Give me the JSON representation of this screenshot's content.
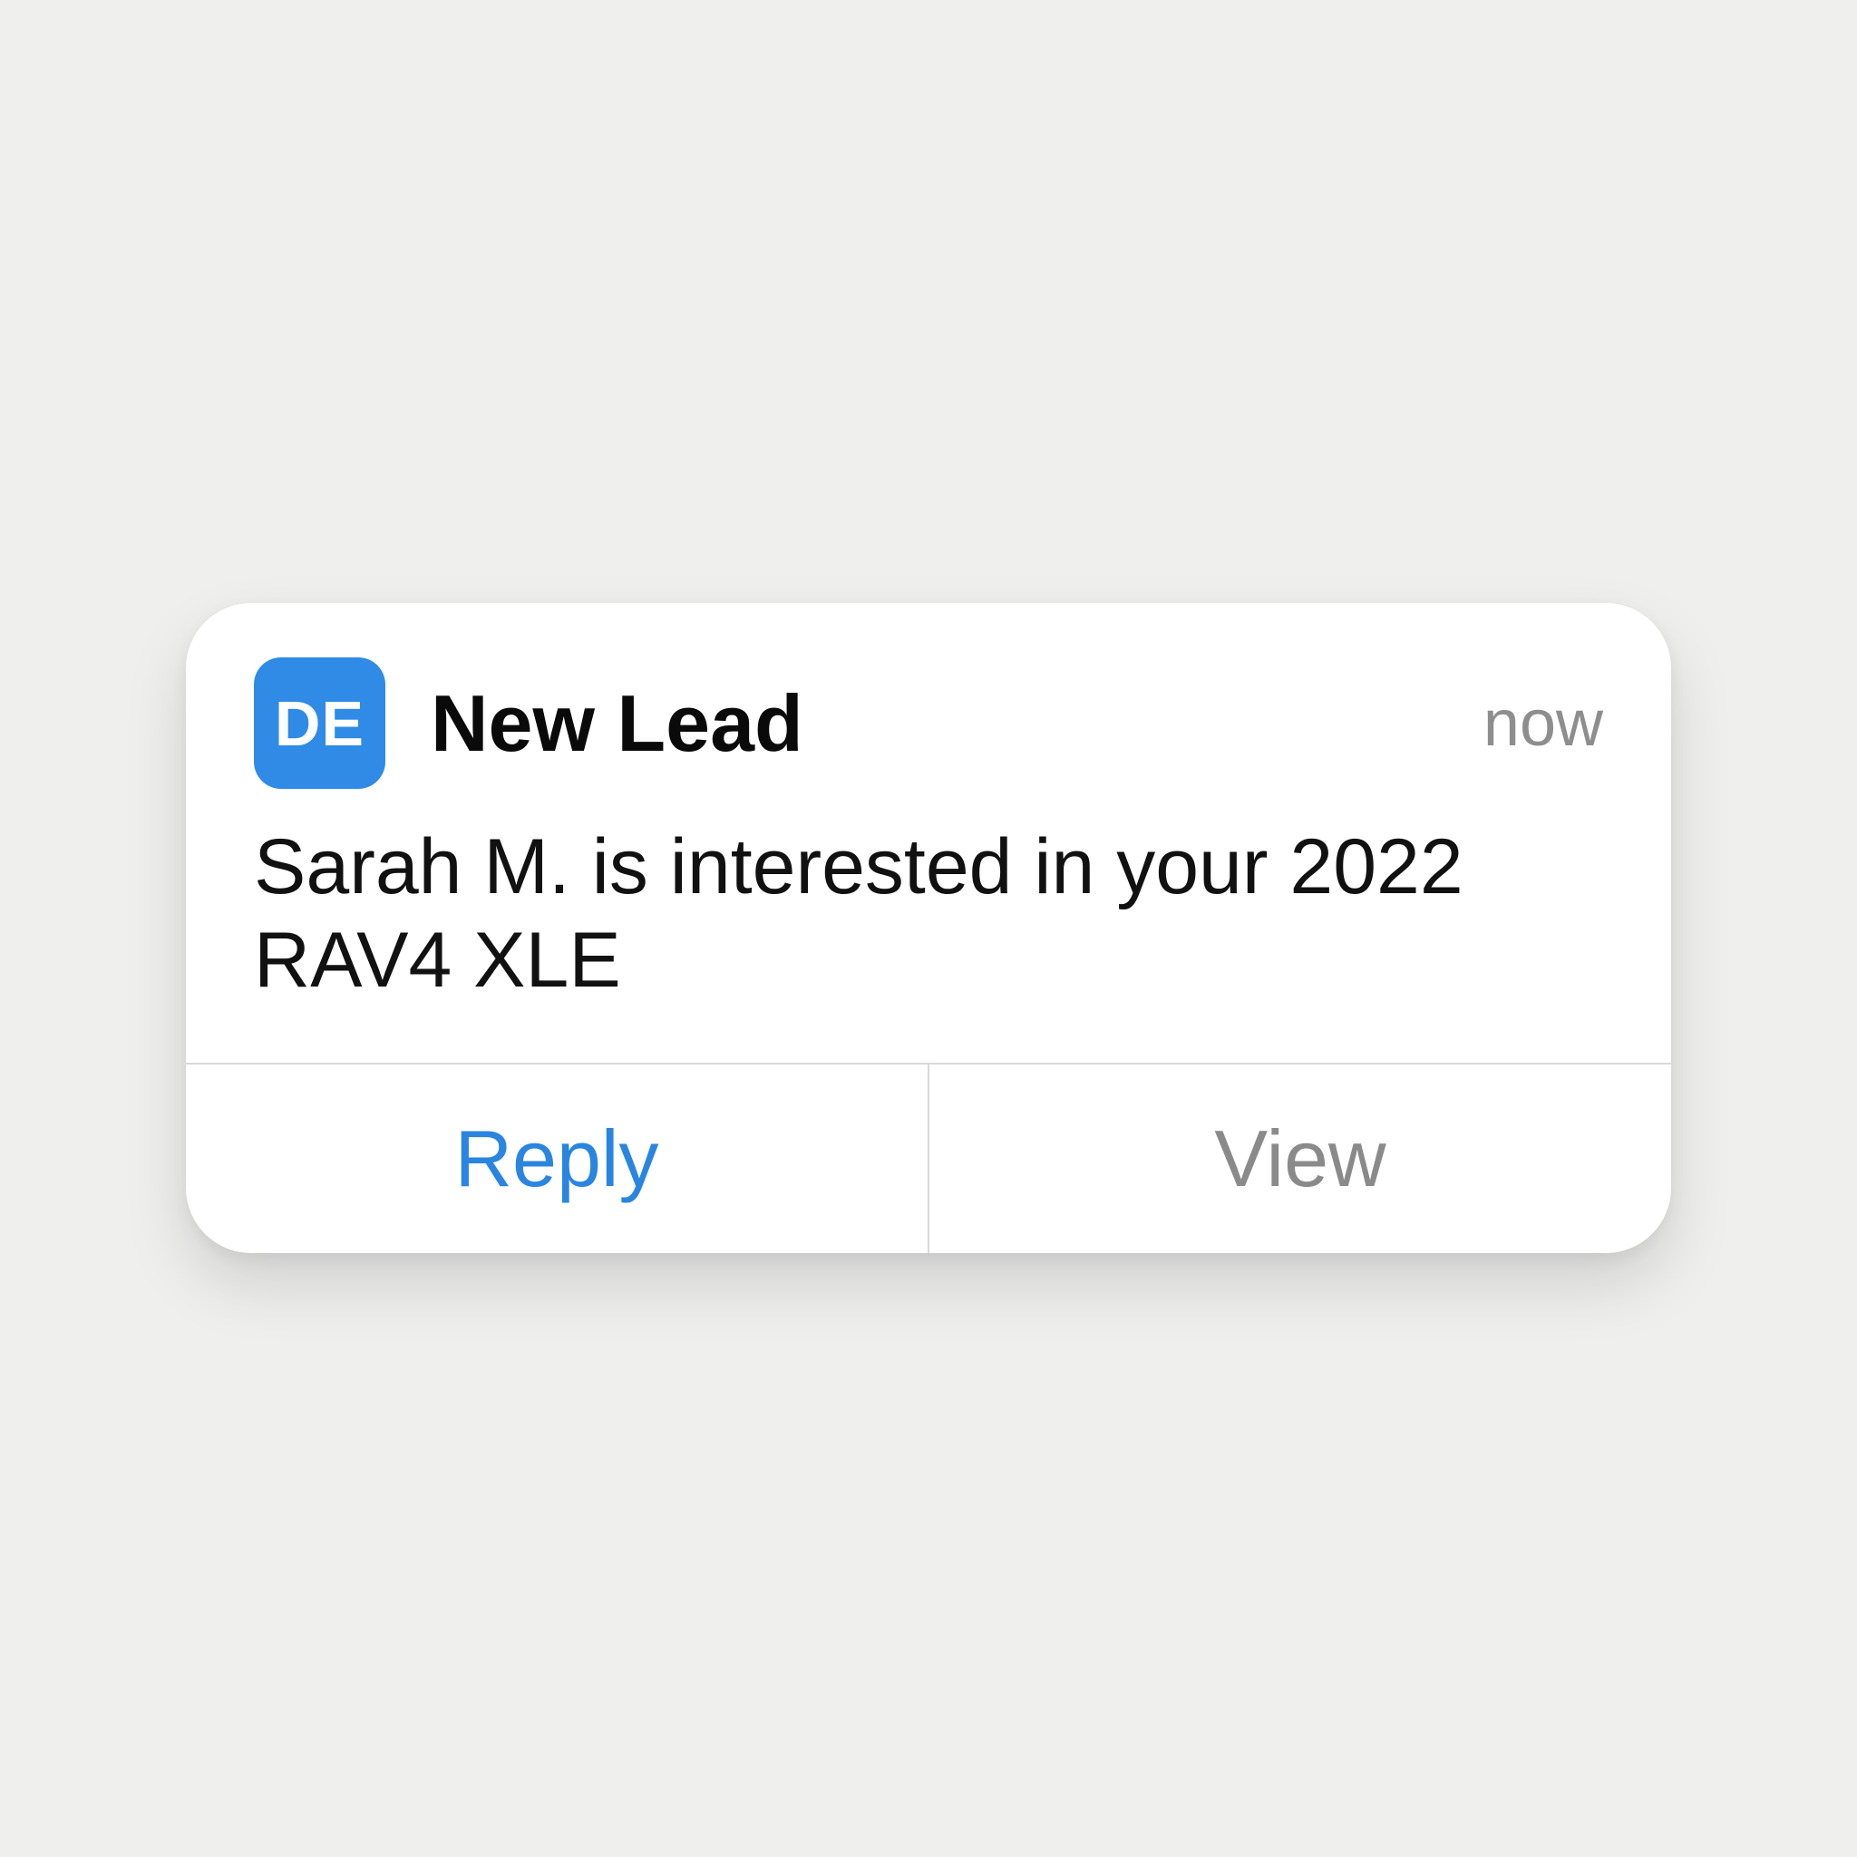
{
  "notification": {
    "app_icon": {
      "text": "DE",
      "color": "#2f8be6"
    },
    "title": "New Lead",
    "timestamp": "now",
    "message": "Sarah M. is interested in your 2022 RAV4 XLE",
    "actions": {
      "reply_label": "Reply",
      "view_label": "View",
      "reply_color": "#2a85e0",
      "view_color": "#8a8a8a"
    }
  }
}
